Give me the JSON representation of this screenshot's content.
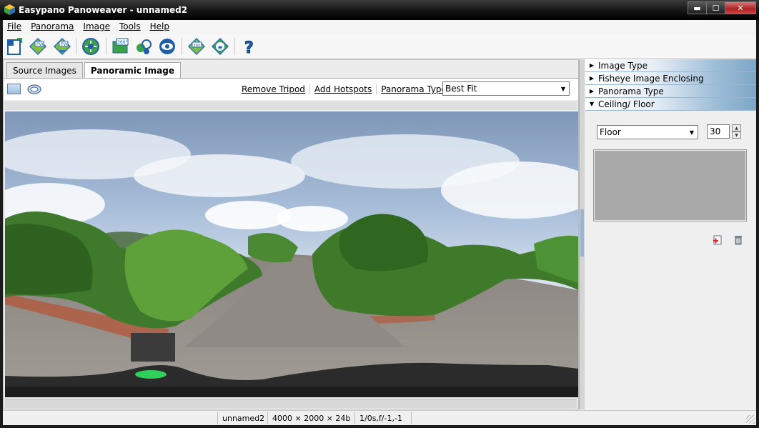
{
  "window": {
    "title": "Easypano Panoweaver - unnamed2",
    "buttons": {
      "minimize": "▬",
      "maximize": "☐",
      "close": "✕"
    }
  },
  "menu": [
    "File",
    "Panorama",
    "Image",
    "Tools",
    "Help"
  ],
  "toolbar": {
    "items": [
      "new-project-icon",
      "pw-open-icon",
      "pw-save-icon",
      "stitch-icon",
      "publish-360-icon",
      "hotspot-icon",
      "preview-eye-icon",
      "publish-360-diamond-icon",
      "publish-e-icon",
      "help-icon"
    ]
  },
  "tabs": [
    "Source Images",
    "Panoramic Image"
  ],
  "panorama_toolbar": {
    "links": [
      "Remove Tripod",
      "Add Hotspots",
      "Panorama Type"
    ],
    "type_value": "Best Fit"
  },
  "right_panel": {
    "sections": [
      {
        "label": "Image Type",
        "expanded": false
      },
      {
        "label": "Fisheye Image Enclosing",
        "expanded": false
      },
      {
        "label": "Panorama Type",
        "expanded": false
      },
      {
        "label": "Ceiling/ Floor",
        "expanded": true
      }
    ],
    "ceiling_floor_value": "Floor",
    "size_value": "30"
  },
  "status": {
    "file": "unnamed2",
    "dimensions": "4000 × 2000 × 24b",
    "exif": "1/0s,f/-1,-1"
  },
  "colors": {
    "accent_blue": "#7da6c7",
    "titlebar": "#111111"
  }
}
